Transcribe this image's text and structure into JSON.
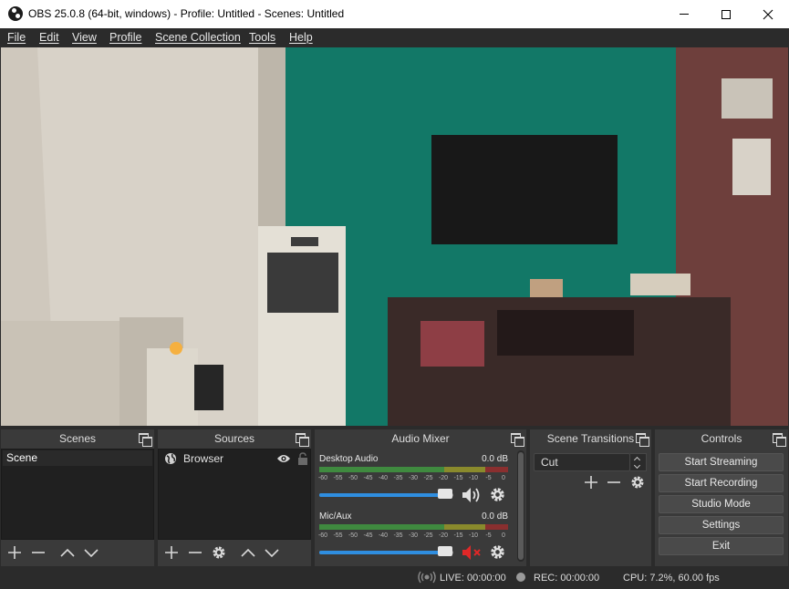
{
  "window": {
    "title": "OBS 25.0.8 (64-bit, windows) - Profile: Untitled - Scenes: Untitled"
  },
  "menu": [
    "File",
    "Edit",
    "View",
    "Profile",
    "Scene Collection",
    "Tools",
    "Help"
  ],
  "docks": {
    "scenes": {
      "title": "Scenes",
      "items": [
        "Scene"
      ]
    },
    "sources": {
      "title": "Sources",
      "items": [
        {
          "label": "Browser",
          "icon": "globe-icon",
          "visible": true,
          "locked": false
        }
      ]
    },
    "mixer": {
      "title": "Audio Mixer",
      "scale": [
        "-60",
        "-55",
        "-50",
        "-45",
        "-40",
        "-35",
        "-30",
        "-25",
        "-20",
        "-15",
        "-10",
        "-5",
        "0"
      ],
      "channels": [
        {
          "name": "Desktop Audio",
          "db": "0.0 dB",
          "muted": false,
          "volume": 0.94
        },
        {
          "name": "Mic/Aux",
          "db": "0.0 dB",
          "muted": true,
          "volume": 0.94
        }
      ]
    },
    "transitions": {
      "title": "Scene Transitions",
      "selected": "Cut"
    },
    "controls": {
      "title": "Controls",
      "buttons": [
        "Start Streaming",
        "Start Recording",
        "Studio Mode",
        "Settings",
        "Exit"
      ]
    }
  },
  "status": {
    "live": "LIVE: 00:00:00",
    "rec": "REC: 00:00:00",
    "cpu": "CPU: 7.2%, 60.00 fps"
  },
  "colors": {
    "accent_blue": "#2f8ee0",
    "mute_red": "#e02828",
    "meter_green": "#3f8a3f",
    "meter_yellow": "#8a8a2c",
    "meter_red": "#8a2f2f",
    "dock_bg": "#3a3a3a",
    "list_bg": "#202020"
  }
}
